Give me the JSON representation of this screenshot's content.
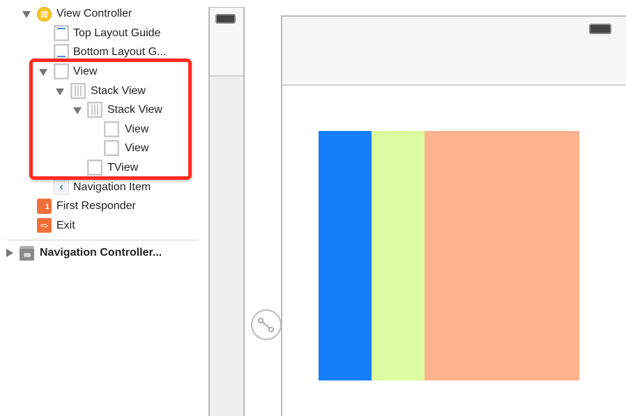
{
  "outline": {
    "items": [
      {
        "label": "View Controller",
        "icon": "view-controller-icon"
      },
      {
        "label": "Top Layout Guide",
        "icon": "layout-guide-icon"
      },
      {
        "label": "Bottom Layout G...",
        "icon": "layout-guide-icon"
      },
      {
        "label": "View",
        "icon": "view-icon"
      },
      {
        "label": "Stack View",
        "icon": "stack-view-icon"
      },
      {
        "label": "Stack View",
        "icon": "stack-view-icon"
      },
      {
        "label": "View",
        "icon": "view-icon"
      },
      {
        "label": "View",
        "icon": "view-icon"
      },
      {
        "label": "TView",
        "icon": "view-icon"
      },
      {
        "label": "Navigation Item",
        "icon": "navigation-item-icon"
      },
      {
        "label": "First Responder",
        "icon": "first-responder-icon"
      },
      {
        "label": "Exit",
        "icon": "exit-icon"
      },
      {
        "label": "Navigation Controller...",
        "icon": "navigation-controller-icon"
      }
    ],
    "highlight_color": "#ff2a1f"
  },
  "canvas": {
    "stack_colors": [
      "#157efb",
      "#ddfca0",
      "#fdb38c"
    ]
  }
}
